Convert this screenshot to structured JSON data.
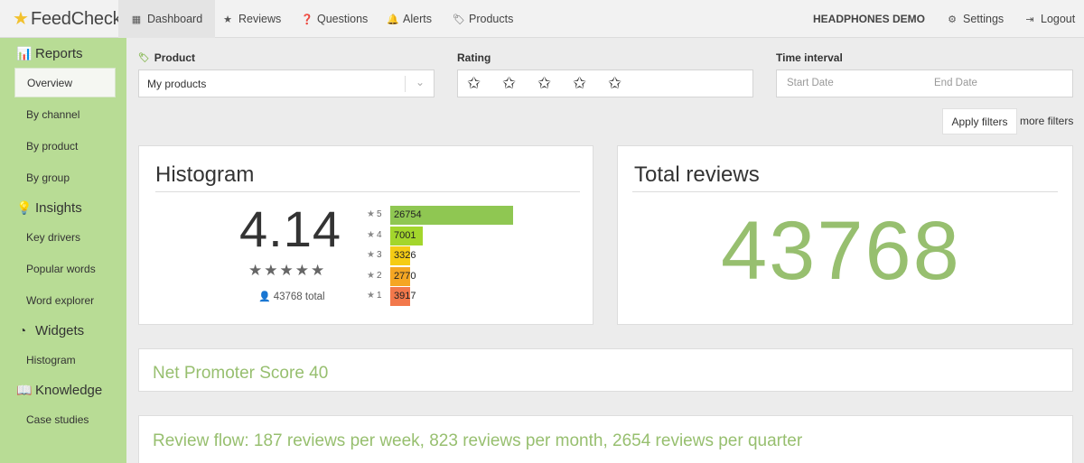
{
  "brand": {
    "name": "FeedCheck"
  },
  "nav": {
    "items": [
      {
        "label": "Dashboard",
        "icon": "grid-icon"
      },
      {
        "label": "Reviews",
        "icon": "star-icon"
      },
      {
        "label": "Questions",
        "icon": "question-icon"
      },
      {
        "label": "Alerts",
        "icon": "bell-icon"
      },
      {
        "label": "Products",
        "icon": "tags-icon"
      }
    ],
    "demo": "HEADPHONES DEMO",
    "settings": "Settings",
    "logout": "Logout"
  },
  "sidebar": {
    "reports": "Reports",
    "overview": "Overview",
    "by_channel": "By channel",
    "by_product": "By product",
    "by_group": "By group",
    "insights": "Insights",
    "key_drivers": "Key drivers",
    "popular_words": "Popular words",
    "word_explorer": "Word explorer",
    "widgets": "Widgets",
    "histogram": "Histogram",
    "knowledge": "Knowledge",
    "case_studies": "Case studies"
  },
  "filters": {
    "product_label": "Product",
    "product_value": "My products",
    "rating_label": "Rating",
    "time_label": "Time interval",
    "start_placeholder": "Start Date",
    "end_placeholder": "End Date",
    "apply": "Apply filters",
    "more": "more filters"
  },
  "histogram": {
    "title": "Histogram",
    "average": "4.14",
    "total_text": "43768 total",
    "rows": [
      {
        "stars": "5",
        "count": 26754,
        "color": "#8fc752"
      },
      {
        "stars": "4",
        "count": 7001,
        "color": "#a3d62c"
      },
      {
        "stars": "3",
        "count": 3326,
        "color": "#f5cc14"
      },
      {
        "stars": "2",
        "count": 2770,
        "color": "#f5a623"
      },
      {
        "stars": "1",
        "count": 3917,
        "color": "#f2784b"
      }
    ]
  },
  "total_reviews": {
    "title": "Total reviews",
    "value": "43768"
  },
  "nps": {
    "text": "Net Promoter Score 40"
  },
  "review_flow": {
    "text": "Review flow: 187 reviews per week, 823 reviews per month, 2654 reviews per quarter"
  }
}
